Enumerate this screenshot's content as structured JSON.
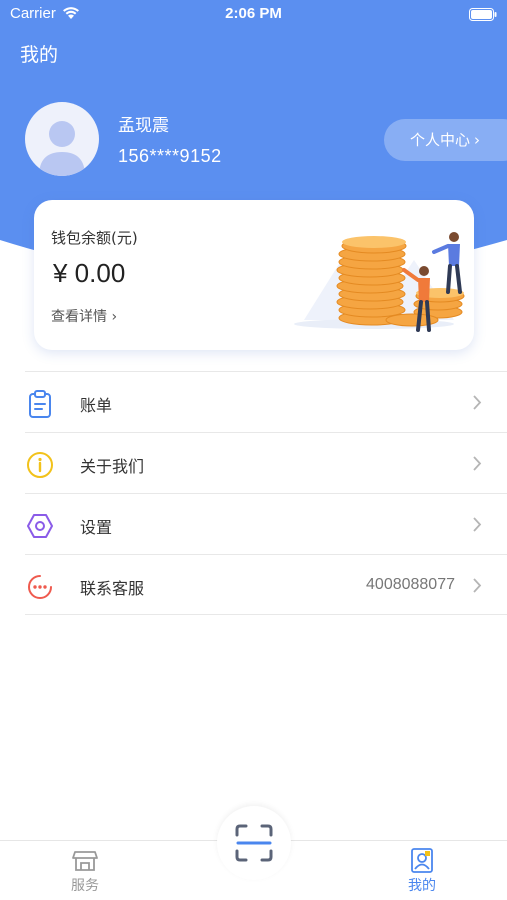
{
  "status_bar": {
    "carrier": "Carrier",
    "time": "2:06 PM"
  },
  "header": {
    "title": "我的"
  },
  "profile": {
    "name": "孟现震",
    "phone": "156****9152",
    "center_button": "个人中心",
    "chevron": "›"
  },
  "wallet": {
    "label": "钱包余额(元)",
    "amount": "¥ 0.00",
    "details_link": "查看详情",
    "chevron": "›"
  },
  "menu": {
    "items": [
      {
        "icon": "clipboard-icon",
        "label": "账单",
        "value": ""
      },
      {
        "icon": "info-icon",
        "label": "关于我们",
        "value": ""
      },
      {
        "icon": "settings-hex-icon",
        "label": "设置",
        "value": ""
      },
      {
        "icon": "chat-bubble-icon",
        "label": "联系客服",
        "value": "4008088077"
      }
    ]
  },
  "tabbar": {
    "tabs": [
      {
        "label": "服务",
        "icon": "store-icon",
        "active": false
      },
      {
        "label": "我的",
        "icon": "profile-card-icon",
        "active": true
      }
    ],
    "center": {
      "icon": "scan-icon"
    }
  },
  "colors": {
    "primary": "#5b8ff0",
    "active_tab": "#4a86ee",
    "inactive_tab": "#999999",
    "coin": "#f5a542",
    "icon_blue": "#4a86ee",
    "icon_yellow": "#f2c21a",
    "icon_purple": "#8a5be8",
    "icon_red": "#ef5a4e"
  }
}
